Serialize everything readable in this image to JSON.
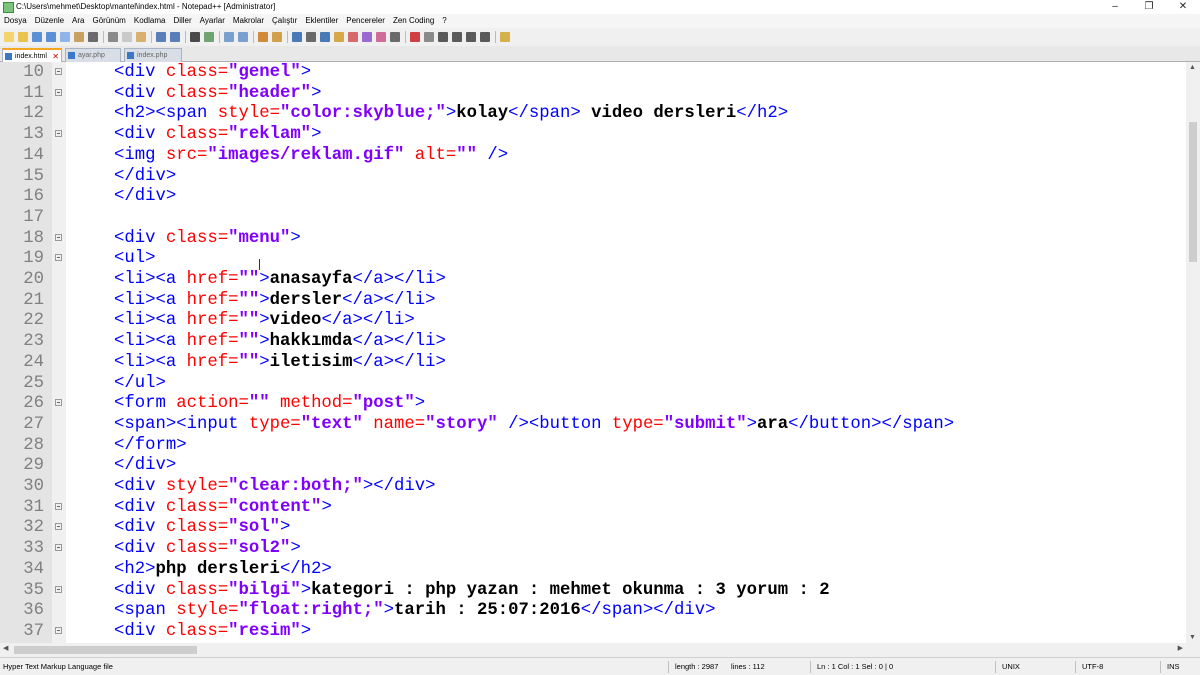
{
  "window": {
    "title": "C:\\Users\\mehmet\\Desktop\\mantel\\index.html - Notepad++ [Administrator]",
    "minimize": "–",
    "maximize": "❐",
    "close": "✕"
  },
  "menu": [
    "Dosya",
    "Düzenle",
    "Ara",
    "Görünüm",
    "Kodlama",
    "Diller",
    "Ayarlar",
    "Makrolar",
    "Çalıştır",
    "Eklentiler",
    "Pencereler",
    "Zen Coding",
    "?"
  ],
  "tabs": [
    {
      "label": "index.html",
      "active": true
    },
    {
      "label": "ayar.php",
      "active": false
    },
    {
      "label": "index.php",
      "active": false
    }
  ],
  "code_lines": [
    {
      "n": "10",
      "fold": true,
      "tokens": [
        [
          "t",
          "<div "
        ],
        [
          "a",
          "class="
        ],
        [
          "v",
          "\"genel\""
        ],
        [
          "t",
          ">"
        ]
      ]
    },
    {
      "n": "11",
      "fold": true,
      "tokens": [
        [
          "t",
          "<div "
        ],
        [
          "a",
          "class="
        ],
        [
          "v",
          "\"header\""
        ],
        [
          "t",
          ">"
        ]
      ]
    },
    {
      "n": "12",
      "fold": false,
      "tokens": [
        [
          "t",
          "<h2><span "
        ],
        [
          "a",
          "style="
        ],
        [
          "v",
          "\"color:skyblue;\""
        ],
        [
          "t",
          ">"
        ],
        [
          "x",
          "kolay"
        ],
        [
          "t",
          "</span> "
        ],
        [
          "x",
          "video dersleri"
        ],
        [
          "t",
          "</h2>"
        ]
      ]
    },
    {
      "n": "13",
      "fold": true,
      "tokens": [
        [
          "t",
          "<div "
        ],
        [
          "a",
          "class="
        ],
        [
          "v",
          "\"reklam\""
        ],
        [
          "t",
          ">"
        ]
      ]
    },
    {
      "n": "14",
      "fold": false,
      "tokens": [
        [
          "t",
          "<img "
        ],
        [
          "a",
          "src="
        ],
        [
          "v",
          "\"images/reklam.gif\""
        ],
        [
          "t",
          " "
        ],
        [
          "a",
          "alt="
        ],
        [
          "v",
          "\"\""
        ],
        [
          "t",
          " />"
        ]
      ]
    },
    {
      "n": "15",
      "fold": false,
      "tokens": [
        [
          "t",
          "</div>"
        ]
      ]
    },
    {
      "n": "16",
      "fold": false,
      "tokens": [
        [
          "t",
          "</div>"
        ]
      ]
    },
    {
      "n": "17",
      "fold": false,
      "tokens": []
    },
    {
      "n": "18",
      "fold": true,
      "tokens": [
        [
          "t",
          "<div "
        ],
        [
          "a",
          "class="
        ],
        [
          "v",
          "\"menu\""
        ],
        [
          "t",
          ">"
        ]
      ]
    },
    {
      "n": "19",
      "fold": true,
      "tokens": [
        [
          "t",
          "<ul>"
        ]
      ]
    },
    {
      "n": "20",
      "fold": false,
      "tokens": [
        [
          "t",
          "<li><a "
        ],
        [
          "a",
          "href="
        ],
        [
          "v",
          "\"\""
        ],
        [
          "t",
          ">"
        ],
        [
          "x",
          "anasayfa"
        ],
        [
          "t",
          "</a></li>"
        ]
      ]
    },
    {
      "n": "21",
      "fold": false,
      "tokens": [
        [
          "t",
          "<li><a "
        ],
        [
          "a",
          "href="
        ],
        [
          "v",
          "\"\""
        ],
        [
          "t",
          ">"
        ],
        [
          "x",
          "dersler"
        ],
        [
          "t",
          "</a></li>"
        ]
      ]
    },
    {
      "n": "22",
      "fold": false,
      "tokens": [
        [
          "t",
          "<li><a "
        ],
        [
          "a",
          "href="
        ],
        [
          "v",
          "\"\""
        ],
        [
          "t",
          ">"
        ],
        [
          "x",
          "video"
        ],
        [
          "t",
          "</a></li>"
        ]
      ]
    },
    {
      "n": "23",
      "fold": false,
      "tokens": [
        [
          "t",
          "<li><a "
        ],
        [
          "a",
          "href="
        ],
        [
          "v",
          "\"\""
        ],
        [
          "t",
          ">"
        ],
        [
          "x",
          "hakkımda"
        ],
        [
          "t",
          "</a></li>"
        ]
      ]
    },
    {
      "n": "24",
      "fold": false,
      "tokens": [
        [
          "t",
          "<li><a "
        ],
        [
          "a",
          "href="
        ],
        [
          "v",
          "\"\""
        ],
        [
          "t",
          ">"
        ],
        [
          "x",
          "iletisim"
        ],
        [
          "t",
          "</a></li>"
        ]
      ]
    },
    {
      "n": "25",
      "fold": false,
      "tokens": [
        [
          "t",
          "</ul>"
        ]
      ]
    },
    {
      "n": "26",
      "fold": true,
      "tokens": [
        [
          "t",
          "<form "
        ],
        [
          "a",
          "action="
        ],
        [
          "v",
          "\"\""
        ],
        [
          "t",
          " "
        ],
        [
          "a",
          "method="
        ],
        [
          "v",
          "\"post\""
        ],
        [
          "t",
          ">"
        ]
      ]
    },
    {
      "n": "27",
      "fold": false,
      "tokens": [
        [
          "t",
          "<span><input "
        ],
        [
          "a",
          "type="
        ],
        [
          "v",
          "\"text\""
        ],
        [
          "t",
          " "
        ],
        [
          "a",
          "name="
        ],
        [
          "v",
          "\"story\""
        ],
        [
          "t",
          " /><button "
        ],
        [
          "a",
          "type="
        ],
        [
          "v",
          "\"submit\""
        ],
        [
          "t",
          ">"
        ],
        [
          "x",
          "ara"
        ],
        [
          "t",
          "</button></span>"
        ]
      ]
    },
    {
      "n": "28",
      "fold": false,
      "tokens": [
        [
          "t",
          "</form>"
        ]
      ]
    },
    {
      "n": "29",
      "fold": false,
      "tokens": [
        [
          "t",
          "</div>"
        ]
      ]
    },
    {
      "n": "30",
      "fold": false,
      "tokens": [
        [
          "t",
          "<div "
        ],
        [
          "a",
          "style="
        ],
        [
          "v",
          "\"clear:both;\""
        ],
        [
          "t",
          "></div>"
        ]
      ]
    },
    {
      "n": "31",
      "fold": true,
      "tokens": [
        [
          "t",
          "<div "
        ],
        [
          "a",
          "class="
        ],
        [
          "v",
          "\"content\""
        ],
        [
          "t",
          ">"
        ]
      ]
    },
    {
      "n": "32",
      "fold": true,
      "tokens": [
        [
          "t",
          "<div "
        ],
        [
          "a",
          "class="
        ],
        [
          "v",
          "\"sol\""
        ],
        [
          "t",
          ">"
        ]
      ]
    },
    {
      "n": "33",
      "fold": true,
      "tokens": [
        [
          "t",
          "<div "
        ],
        [
          "a",
          "class="
        ],
        [
          "v",
          "\"sol2\""
        ],
        [
          "t",
          ">"
        ]
      ]
    },
    {
      "n": "34",
      "fold": false,
      "tokens": [
        [
          "t",
          "<h2>"
        ],
        [
          "x",
          "php dersleri"
        ],
        [
          "t",
          "</h2>"
        ]
      ]
    },
    {
      "n": "35",
      "fold": true,
      "tokens": [
        [
          "t",
          "<div "
        ],
        [
          "a",
          "class="
        ],
        [
          "v",
          "\"bilgi\""
        ],
        [
          "t",
          ">"
        ],
        [
          "x",
          "kategori : php yazan : mehmet okunma : 3 yorum : 2"
        ]
      ]
    },
    {
      "n": "36",
      "fold": false,
      "tokens": [
        [
          "t",
          "<span "
        ],
        [
          "a",
          "style="
        ],
        [
          "v",
          "\"float:right;\""
        ],
        [
          "t",
          ">"
        ],
        [
          "x",
          "tarih : 25:07:2016"
        ],
        [
          "t",
          "</span></div>"
        ]
      ]
    },
    {
      "n": "37",
      "fold": true,
      "tokens": [
        [
          "t",
          "<div "
        ],
        [
          "a",
          "class="
        ],
        [
          "v",
          "\"resim\""
        ],
        [
          "t",
          ">"
        ]
      ]
    }
  ],
  "status": {
    "filetype": "Hyper Text Markup Language file",
    "length": "length : 2987",
    "lines": "lines : 112",
    "position": "Ln : 1    Col : 1    Sel : 0 | 0",
    "eol": "UNIX",
    "encoding": "UTF-8",
    "mode": "INS"
  },
  "colors": {
    "tag": "#0000ff",
    "attribute": "#ff0000",
    "value": "#8000ff",
    "text": "#000000"
  }
}
